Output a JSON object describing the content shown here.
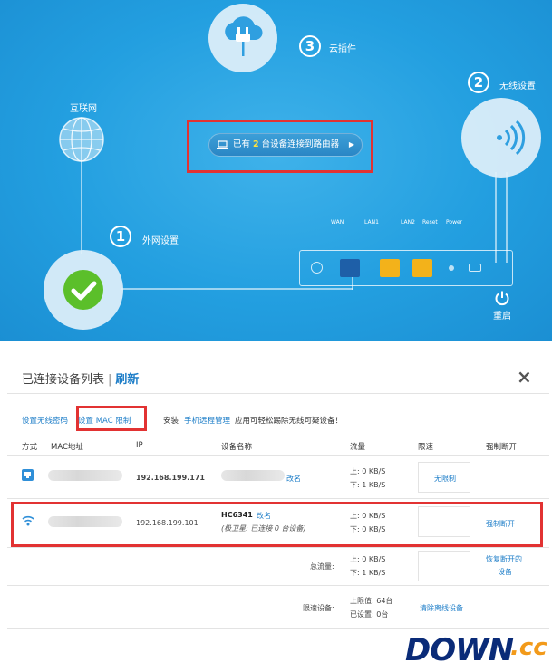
{
  "router_panel": {
    "cloud": {
      "step": "3",
      "label": "云插件",
      "icon": "cloud-plug-icon"
    },
    "internet": {
      "label": "互联网",
      "icon": "globe-icon"
    },
    "wireless": {
      "step": "2",
      "label": "无线设置",
      "icon": "wifi-signal-icon"
    },
    "wan_setup": {
      "step": "1",
      "label": "外网设置",
      "icon": "check-icon"
    },
    "connected_pill": {
      "prefix": "已有",
      "count": "2",
      "suffix": "台设备连接到路由器",
      "icon": "laptop-icon",
      "arrow": "▶"
    },
    "ports": {
      "wan": "WAN",
      "lan1": "LAN1",
      "lan2": "LAN2",
      "reset": "Reset",
      "power": "Power"
    },
    "restart": {
      "label": "重启",
      "icon": "power-icon"
    },
    "colors": {
      "background": "#239fe0",
      "highlight": "#e23232",
      "count_yellow": "#ffe23c",
      "check_green": "#5bbf2a"
    }
  },
  "device_list": {
    "title": "已连接设备列表",
    "separator": "|",
    "refresh": "刷新",
    "close": "×",
    "links": {
      "wifi_password": "设置无线密码",
      "mac_filter": "设置 MAC 限制",
      "install_prefix": "安装",
      "remote_app": "手机远程管理",
      "install_suffix": "应用可轻松踢除无线可疑设备！"
    },
    "columns": [
      "方式",
      "MAC地址",
      "IP",
      "设备名称",
      "流量",
      "限速",
      "强制断开"
    ],
    "rows": [
      {
        "type_icon": "ethernet-icon",
        "ip": "192.168.199.171",
        "name": "",
        "rename": "改名",
        "up": "上: 0 KB/S",
        "down": "下: 1 KB/S",
        "rate": "无限制",
        "disconnect": ""
      },
      {
        "type_icon": "wifi-icon",
        "ip": "192.168.199.101",
        "name": "HC6341",
        "rename": "改名",
        "note": "(极卫星: 已连接 0 台设备)",
        "up": "上: 0 KB/S",
        "down": "下: 0 KB/S",
        "rate": "",
        "disconnect": "强制断开"
      }
    ],
    "total": {
      "label": "总流量:",
      "up": "上: 0 KB/S",
      "down": "下: 1 KB/S",
      "restore_line1": "恢复断开的",
      "restore_line2": "设备"
    },
    "limit": {
      "label": "限速设备:",
      "max": "上限值: 64台",
      "set": "已设置: 0台",
      "clear": "清除离线设备"
    }
  },
  "watermark": {
    "main": "DOWN",
    "suffix": ".cc"
  }
}
